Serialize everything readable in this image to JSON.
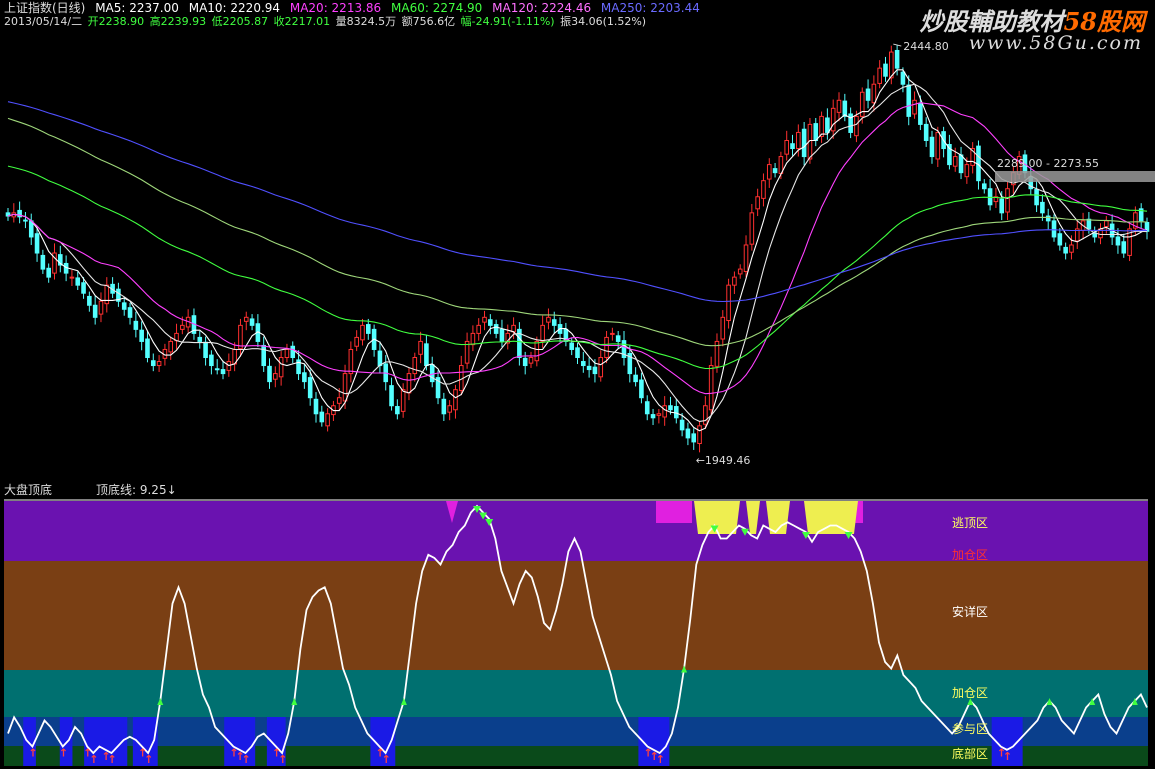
{
  "header": {
    "title": "上证指数(日线)",
    "ma5": "MA5: 2237.00",
    "ma10": "MA10: 2220.94",
    "ma20": "MA20: 2213.86",
    "ma60": "MA60: 2274.90",
    "ma120": "MA120: 2224.46",
    "ma250": "MA250: 2203.44",
    "date": "2013/05/14/二",
    "open": "开2238.90",
    "high": "高2239.93",
    "low": "低2205.87",
    "close": "收2217.01",
    "volume": "量8324.5万",
    "amount": "额756.6亿",
    "change": "幅-24.91(-1.11%)",
    "amplitude": "振34.06(1.52%)"
  },
  "watermark": {
    "text1": "炒股輔助教材",
    "text2": "58股网",
    "url": "www.58Gu.com"
  },
  "annotations": {
    "high": "2444.80",
    "low": "←1949.46",
    "band": "2289.00 - 2273.55"
  },
  "indicator": {
    "name": "大盘顶底",
    "value_label": "顶底线: 9.25↓",
    "zones": [
      "逃顶区",
      "加仓区",
      "安详区",
      "加仓区",
      "参与区",
      "底部区"
    ]
  },
  "colors": {
    "up": "#ff3030",
    "down": "#54ffff",
    "ma5": "#ffffff",
    "ma10": "#ffffff",
    "ma20": "#ff40ff",
    "ma60": "#40ff40",
    "ma120": "#ffff40",
    "ma250": "#5050ff"
  },
  "chart_data": {
    "type": "candlestick",
    "price_range": [
      1949.46,
      2444.8
    ],
    "close": [
      2236,
      2240,
      2235,
      2230,
      2210,
      2190,
      2170,
      2160,
      2190,
      2175,
      2165,
      2160,
      2150,
      2140,
      2125,
      2110,
      2130,
      2150,
      2140,
      2130,
      2120,
      2110,
      2095,
      2080,
      2060,
      2050,
      2055,
      2070,
      2080,
      2090,
      2100,
      2110,
      2090,
      2080,
      2060,
      2050,
      2045,
      2040,
      2055,
      2070,
      2100,
      2110,
      2100,
      2080,
      2050,
      2030,
      2040,
      2060,
      2070,
      2060,
      2040,
      2030,
      2010,
      1990,
      1980,
      1990,
      2000,
      2010,
      2040,
      2070,
      2085,
      2100,
      2090,
      2070,
      2050,
      2030,
      2000,
      1990,
      2020,
      2040,
      2060,
      2080,
      2050,
      2030,
      2010,
      1990,
      2000,
      2020,
      2050,
      2080,
      2090,
      2100,
      2110,
      2100,
      2090,
      2080,
      2090,
      2100,
      2060,
      2050,
      2060,
      2080,
      2100,
      2110,
      2100,
      2090,
      2080,
      2070,
      2060,
      2050,
      2045,
      2040,
      2060,
      2085,
      2090,
      2080,
      2060,
      2040,
      2030,
      2010,
      1990,
      1985,
      1990,
      2000,
      1995,
      1985,
      1970,
      1960,
      1955,
      1975,
      2000,
      2050,
      2080,
      2110,
      2150,
      2160,
      2170,
      2200,
      2240,
      2260,
      2280,
      2300,
      2290,
      2310,
      2330,
      2320,
      2340,
      2310,
      2350,
      2330,
      2360,
      2340,
      2370,
      2380,
      2360,
      2340,
      2360,
      2390,
      2380,
      2400,
      2420,
      2410,
      2440,
      2420,
      2400,
      2360,
      2380,
      2350,
      2330,
      2310,
      2340,
      2320,
      2300,
      2310,
      2290,
      2300,
      2320,
      2280,
      2270,
      2250,
      2260,
      2240,
      2270,
      2290,
      2310,
      2290,
      2270,
      2250,
      2240,
      2230,
      2210,
      2200,
      2190,
      2200,
      2220,
      2230,
      2220,
      2210,
      2220,
      2230,
      2210,
      2200,
      2190,
      2220,
      2240,
      2230,
      2217
    ],
    "overlays": [
      "MA5",
      "MA10",
      "MA20",
      "MA60",
      "MA120",
      "MA250"
    ],
    "sub_series": {
      "name": "顶底线",
      "range": [
        0,
        100
      ],
      "values": [
        10,
        15,
        12,
        8,
        6,
        10,
        14,
        12,
        9,
        6,
        8,
        12,
        10,
        6,
        4,
        6,
        5,
        4,
        6,
        8,
        9,
        8,
        6,
        4,
        8,
        20,
        35,
        50,
        55,
        50,
        40,
        30,
        22,
        18,
        12,
        10,
        8,
        6,
        5,
        4,
        6,
        9,
        10,
        8,
        6,
        4,
        10,
        20,
        36,
        48,
        52,
        54,
        55,
        50,
        40,
        30,
        25,
        18,
        14,
        10,
        8,
        6,
        4,
        8,
        14,
        20,
        35,
        50,
        60,
        65,
        64,
        62,
        66,
        68,
        72,
        74,
        78,
        80,
        78,
        76,
        70,
        60,
        55,
        50,
        56,
        60,
        58,
        52,
        44,
        42,
        48,
        56,
        66,
        70,
        66,
        56,
        46,
        40,
        34,
        28,
        20,
        16,
        12,
        10,
        8,
        6,
        5,
        4,
        6,
        10,
        18,
        30,
        45,
        62,
        68,
        72,
        74,
        70,
        70,
        72,
        74,
        73,
        71,
        70,
        74,
        73,
        72,
        74,
        75,
        74,
        73,
        72,
        69,
        72,
        73,
        74,
        74,
        73,
        72,
        70,
        66,
        60,
        50,
        38,
        32,
        30,
        34,
        28,
        26,
        24,
        20,
        18,
        16,
        14,
        12,
        10,
        12,
        16,
        20,
        18,
        14,
        10,
        8,
        6,
        5,
        6,
        8,
        10,
        12,
        14,
        18,
        20,
        18,
        14,
        12,
        10,
        14,
        18,
        20,
        22,
        16,
        12,
        10,
        14,
        18,
        20,
        22,
        18
      ]
    }
  }
}
